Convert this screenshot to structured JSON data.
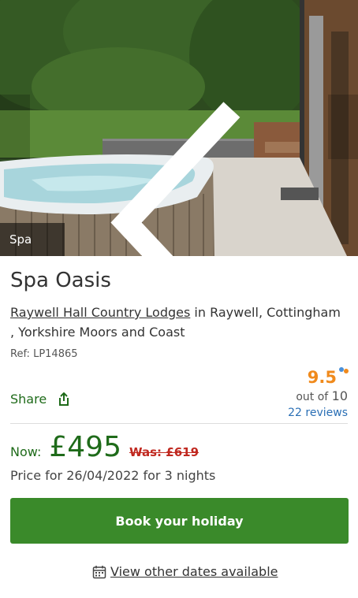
{
  "hero": {
    "caption": "Spa Oasis",
    "prev_icon": "chevron-left-icon",
    "next_icon": "chevron-right-icon"
  },
  "listing": {
    "title": "Spa Oasis",
    "park_link": "Raywell Hall Country Lodges",
    "location_text": " in Raywell, Cottingham , Yorkshire Moors and Coast",
    "ref": "Ref: LP14865"
  },
  "share": {
    "label": "Share",
    "icon": "share-icon"
  },
  "rating": {
    "score": "9.5",
    "out_of_label": "out of",
    "out_of_value": "10",
    "reviews": "22 reviews"
  },
  "price": {
    "now_label": "Now:",
    "now_value": "£495",
    "was_value": "Was: £619",
    "note": "Price for 26/04/2022 for 3 nights"
  },
  "actions": {
    "book_label": "Book your holiday",
    "other_dates_label": "View other dates available",
    "calendar_icon": "calendar-icon"
  },
  "colors": {
    "brand_green": "#1f6b1a",
    "button_green": "#3a8a2a",
    "rating_orange": "#f08a1c",
    "was_red": "#c0281f",
    "link_blue": "#2a6fb5"
  }
}
